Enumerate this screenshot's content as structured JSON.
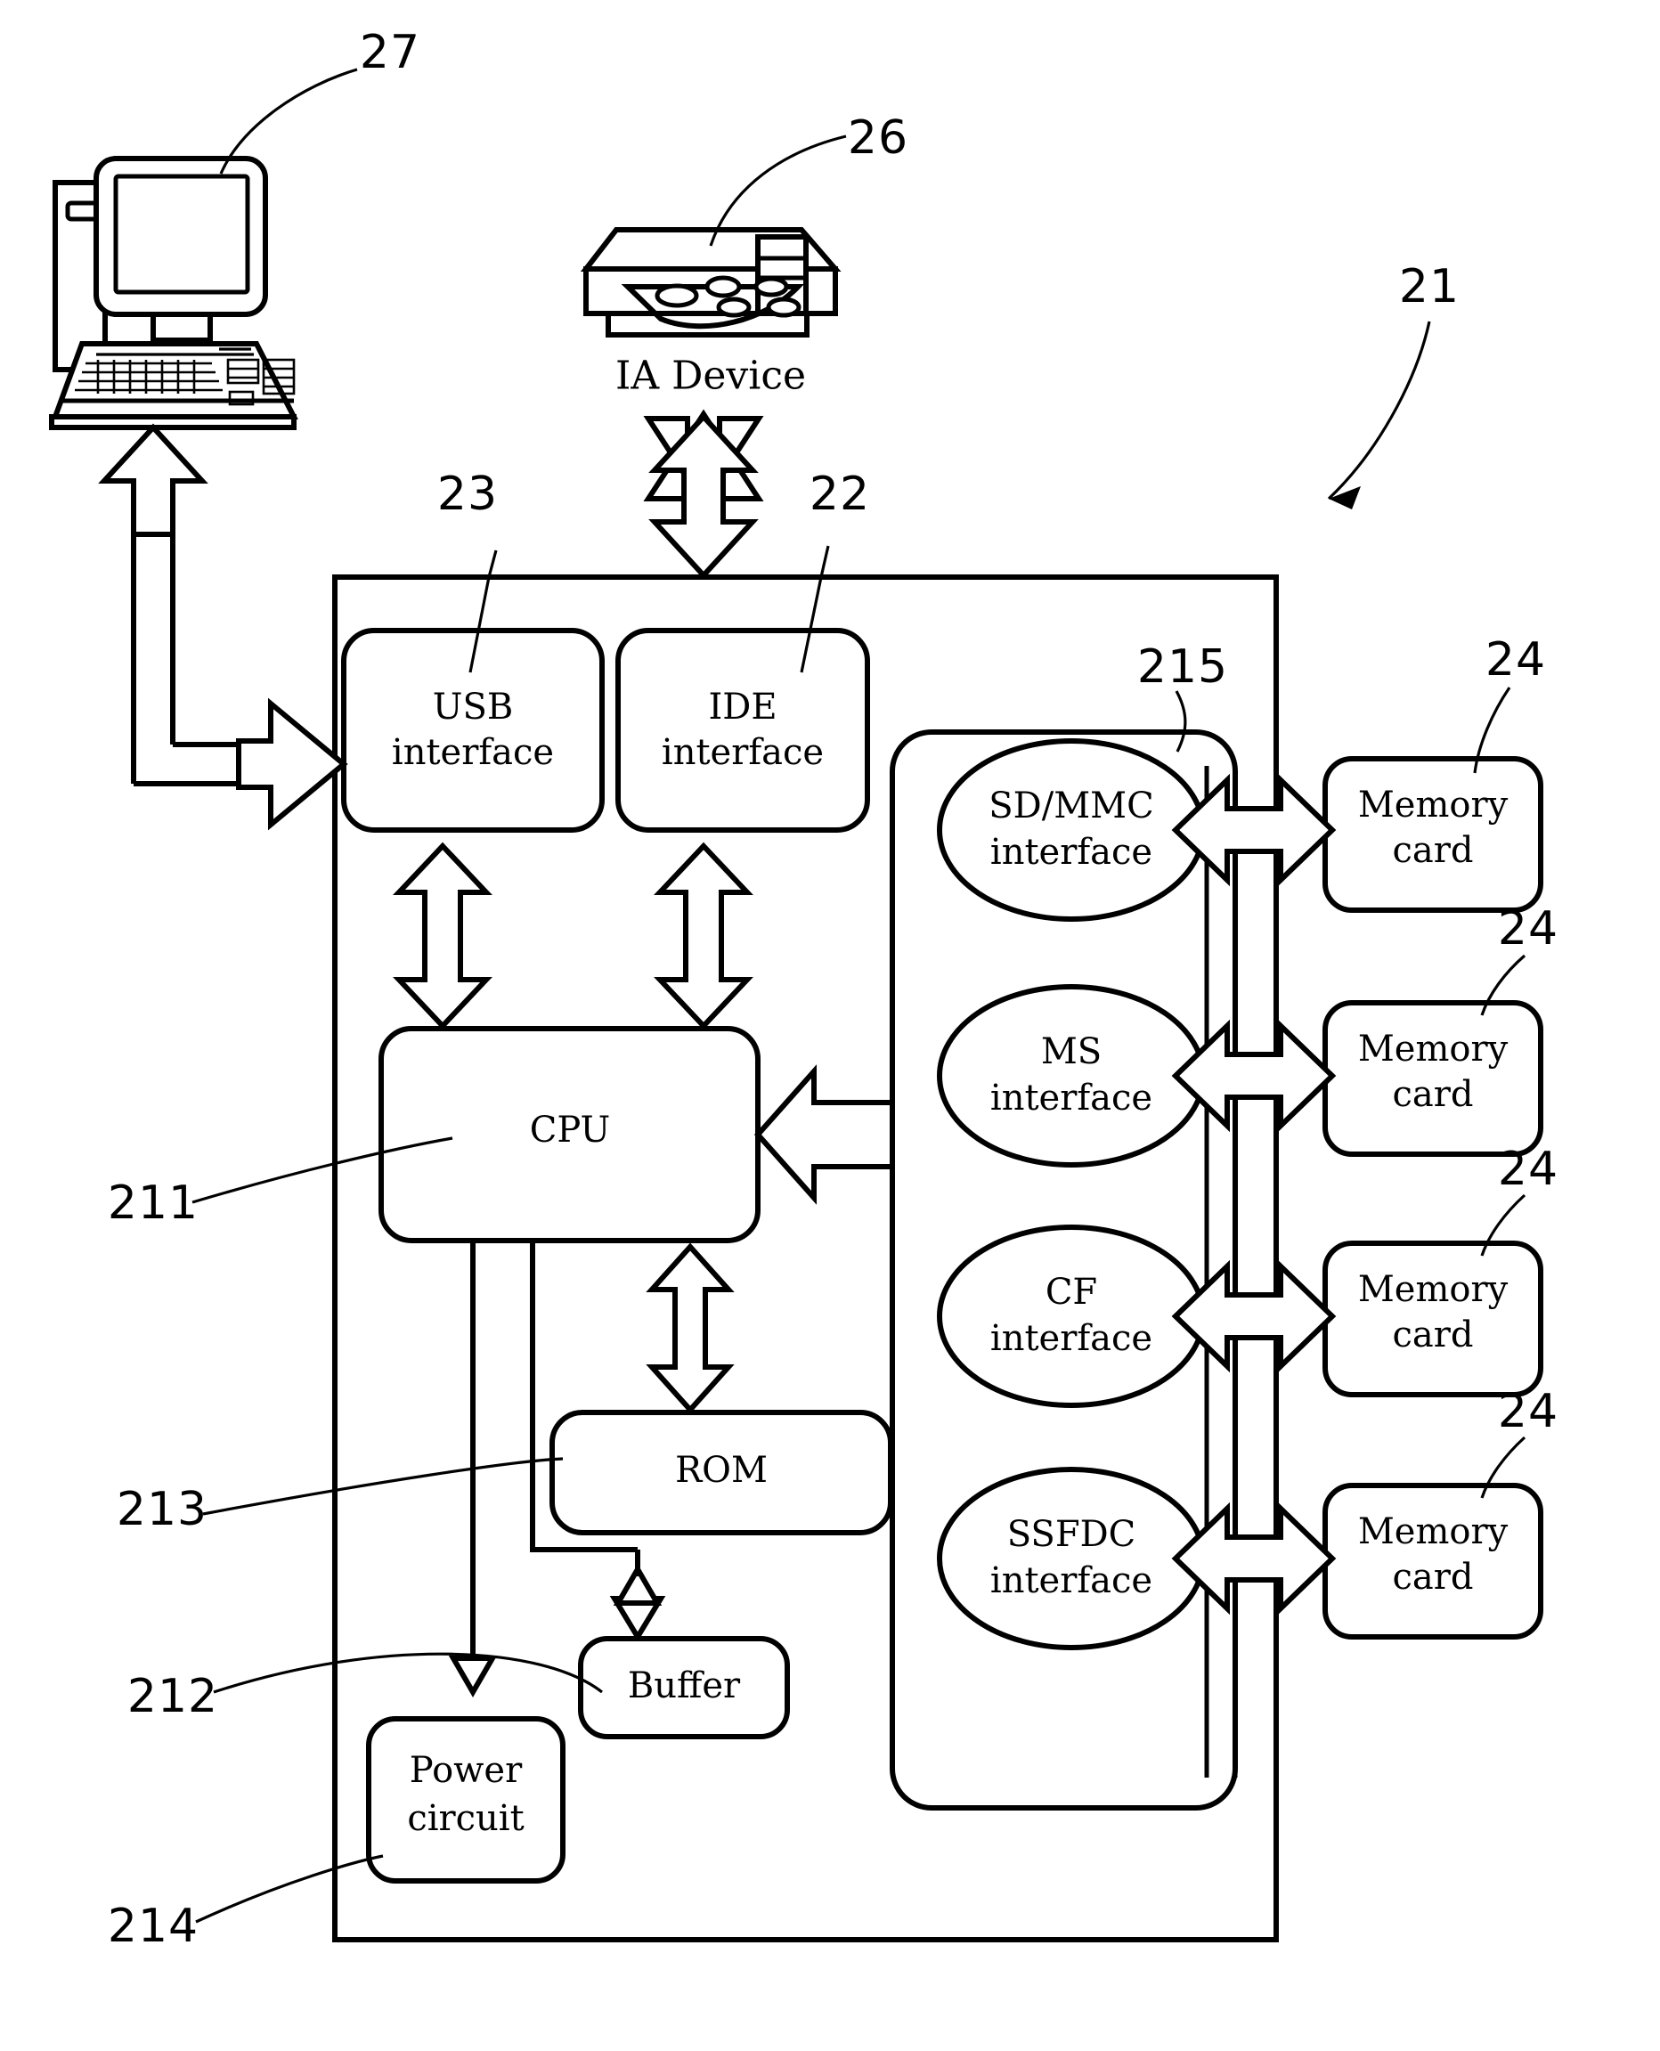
{
  "figure": {
    "type": "patent-block-diagram",
    "title": "Memory card reader block diagram",
    "background_color": "#ffffff",
    "line_color": "#000000"
  },
  "external_devices": [
    {
      "id": "computer",
      "icon": "desktop-computer-icon",
      "caption": "",
      "ref": "27"
    },
    {
      "id": "ia_device",
      "icon": "ia-device-icon",
      "caption": "IA Device",
      "ref": "26"
    }
  ],
  "main_unit": {
    "ref": "21",
    "blocks": [
      {
        "id": "usb_interface",
        "line1": "USB",
        "line2": "interface",
        "ref": "23",
        "shape": "rounded-rect"
      },
      {
        "id": "ide_interface",
        "line1": "IDE",
        "line2": "interface",
        "ref": "22",
        "shape": "rounded-rect"
      },
      {
        "id": "cpu",
        "line1": "CPU",
        "line2": "",
        "ref": "211",
        "shape": "rounded-rect"
      },
      {
        "id": "rom",
        "line1": "ROM",
        "line2": "",
        "ref": "213",
        "shape": "rounded-rect"
      },
      {
        "id": "buffer",
        "line1": "Buffer",
        "line2": "",
        "ref": "212",
        "shape": "rounded-rect"
      },
      {
        "id": "power_circuit",
        "line1": "Power",
        "line2": "circuit",
        "ref": "214",
        "shape": "rounded-rect"
      }
    ],
    "interface_group": {
      "id": "card_interface_group",
      "ref": "215",
      "interfaces": [
        {
          "id": "sd_mmc_interface",
          "line1": "SD/MMC",
          "line2": "interface",
          "shape": "ellipse"
        },
        {
          "id": "ms_interface",
          "line1": "MS",
          "line2": "interface",
          "shape": "ellipse"
        },
        {
          "id": "cf_interface",
          "line1": "CF",
          "line2": "interface",
          "shape": "ellipse"
        },
        {
          "id": "ssfdc_interface",
          "line1": "SSFDC",
          "line2": "interface",
          "shape": "ellipse"
        }
      ]
    }
  },
  "memory_cards": [
    {
      "id": "memory_card_1",
      "line1": "Memory",
      "line2": "card",
      "ref": "24"
    },
    {
      "id": "memory_card_2",
      "line1": "Memory",
      "line2": "card",
      "ref": "24"
    },
    {
      "id": "memory_card_3",
      "line1": "Memory",
      "line2": "card",
      "ref": "24"
    },
    {
      "id": "memory_card_4",
      "line1": "Memory",
      "line2": "card",
      "ref": "24"
    }
  ],
  "reference_numerals": {
    "n27": "27",
    "n26": "26",
    "n21": "21",
    "n23": "23",
    "n22": "22",
    "n215": "215",
    "n24_1": "24",
    "n24_2": "24",
    "n24_3": "24",
    "n24_4": "24",
    "n211": "211",
    "n213": "213",
    "n212": "212",
    "n214": "214"
  },
  "labels": {
    "ia_device": "IA Device",
    "usb_line1": "USB",
    "usb_line2": "interface",
    "ide_line1": "IDE",
    "ide_line2": "interface",
    "cpu": "CPU",
    "rom": "ROM",
    "buffer": "Buffer",
    "power_line1": "Power",
    "power_line2": "circuit",
    "sdmmc_line1": "SD/MMC",
    "sdmmc_line2": "interface",
    "ms_line1": "MS",
    "ms_line2": "interface",
    "cf_line1": "CF",
    "cf_line2": "interface",
    "ssfdc_line1": "SSFDC",
    "ssfdc_line2": "interface",
    "mem1_line1": "Memory",
    "mem1_line2": "card",
    "mem2_line1": "Memory",
    "mem2_line2": "card",
    "mem3_line1": "Memory",
    "mem3_line2": "card",
    "mem4_line1": "Memory",
    "mem4_line2": "card"
  }
}
